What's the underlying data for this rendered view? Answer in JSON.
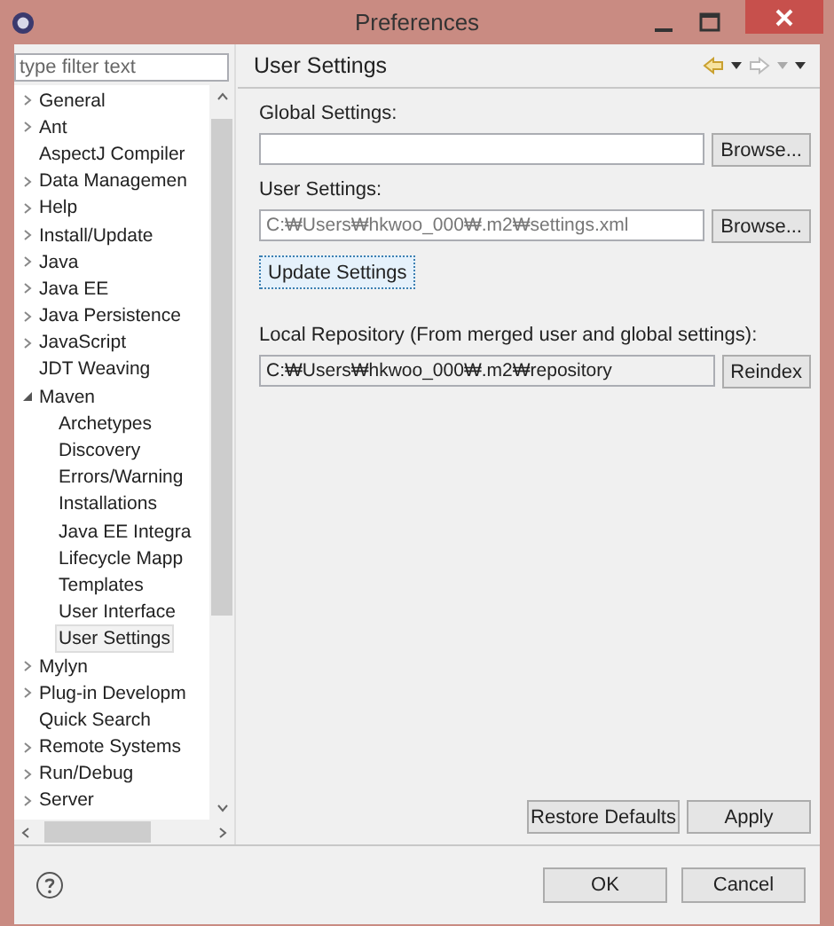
{
  "window": {
    "title": "Preferences"
  },
  "filter": {
    "placeholder": "type filter text"
  },
  "tree": [
    {
      "label": "General",
      "kind": "group",
      "expanded": false,
      "selected": false
    },
    {
      "label": "Ant",
      "kind": "group",
      "expanded": false,
      "selected": false
    },
    {
      "label": "AspectJ Compiler",
      "kind": "leaf",
      "selected": false
    },
    {
      "label": "Data Managemen",
      "kind": "group",
      "expanded": false,
      "selected": false
    },
    {
      "label": "Help",
      "kind": "group",
      "expanded": false,
      "selected": false
    },
    {
      "label": "Install/Update",
      "kind": "group",
      "expanded": false,
      "selected": false
    },
    {
      "label": "Java",
      "kind": "group",
      "expanded": false,
      "selected": false
    },
    {
      "label": "Java EE",
      "kind": "group",
      "expanded": false,
      "selected": false
    },
    {
      "label": "Java Persistence",
      "kind": "group",
      "expanded": false,
      "selected": false
    },
    {
      "label": "JavaScript",
      "kind": "group",
      "expanded": false,
      "selected": false
    },
    {
      "label": "JDT Weaving",
      "kind": "leaf",
      "selected": false
    },
    {
      "label": "Maven",
      "kind": "group",
      "expanded": true,
      "selected": false,
      "children": [
        {
          "label": "Archetypes",
          "selected": false
        },
        {
          "label": "Discovery",
          "selected": false
        },
        {
          "label": "Errors/Warning",
          "selected": false
        },
        {
          "label": "Installations",
          "selected": false
        },
        {
          "label": "Java EE Integra",
          "selected": false
        },
        {
          "label": "Lifecycle Mapp",
          "selected": false
        },
        {
          "label": "Templates",
          "selected": false
        },
        {
          "label": "User Interface",
          "selected": false
        },
        {
          "label": "User Settings",
          "selected": true
        }
      ]
    },
    {
      "label": "Mylyn",
      "kind": "group",
      "expanded": false,
      "selected": false
    },
    {
      "label": "Plug-in Developm",
      "kind": "group",
      "expanded": false,
      "selected": false
    },
    {
      "label": "Quick Search",
      "kind": "leaf",
      "selected": false
    },
    {
      "label": "Remote Systems",
      "kind": "group",
      "expanded": false,
      "selected": false
    },
    {
      "label": "Run/Debug",
      "kind": "group",
      "expanded": false,
      "selected": false
    },
    {
      "label": "Server",
      "kind": "group",
      "expanded": false,
      "selected": false
    }
  ],
  "page": {
    "title": "User Settings",
    "global_settings": {
      "label": "Global Settings:",
      "button": "Browse..."
    },
    "user_settings": {
      "label": "User Settings:",
      "value": "C:₩Users₩hkwoo_000₩.m2₩settings.xml",
      "button": "Browse..."
    },
    "update_button": "Update Settings",
    "local_repository": {
      "label": "Local Repository (From merged user and global settings):",
      "value": "C:₩Users₩hkwoo_000₩.m2₩repository",
      "button": "Reindex"
    },
    "restore_button": "Restore Defaults",
    "apply_button": "Apply"
  },
  "buttons": {
    "ok": "OK",
    "cancel": "Cancel"
  }
}
